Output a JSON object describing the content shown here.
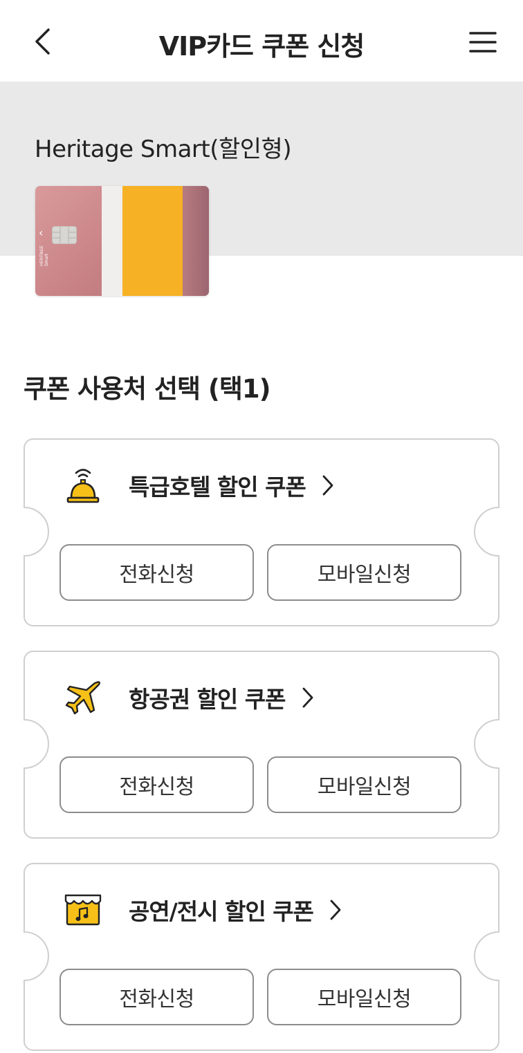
{
  "header": {
    "title": "VIP카드 쿠폰 신청",
    "back_icon": "chevron-left-icon",
    "menu_icon": "hamburger-menu-icon"
  },
  "card": {
    "name": "Heritage Smart(할인형)",
    "brand_line1": "HERITAGE",
    "brand_line2": "Smart",
    "colors": {
      "body": "#c98487",
      "stripe_white": "#f1eeee",
      "stripe_yellow": "#f6b124"
    }
  },
  "section": {
    "title": "쿠폰 사용처 선택 (택1)"
  },
  "coupons": [
    {
      "icon": "hotel-bell-icon",
      "title": "특급호텔 할인 쿠폰",
      "phone_label": "전화신청",
      "mobile_label": "모바일신청"
    },
    {
      "icon": "airplane-icon",
      "title": "항공권 할인 쿠폰",
      "phone_label": "전화신청",
      "mobile_label": "모바일신청"
    },
    {
      "icon": "theater-music-icon",
      "title": "공연/전시 할인 쿠폰",
      "phone_label": "전화신청",
      "mobile_label": "모바일신청"
    }
  ],
  "colors": {
    "accent_yellow": "#f6c018",
    "band_gray": "#e9e9e9",
    "border_gray": "#cfcfcf",
    "button_border": "#8c8c8c"
  }
}
